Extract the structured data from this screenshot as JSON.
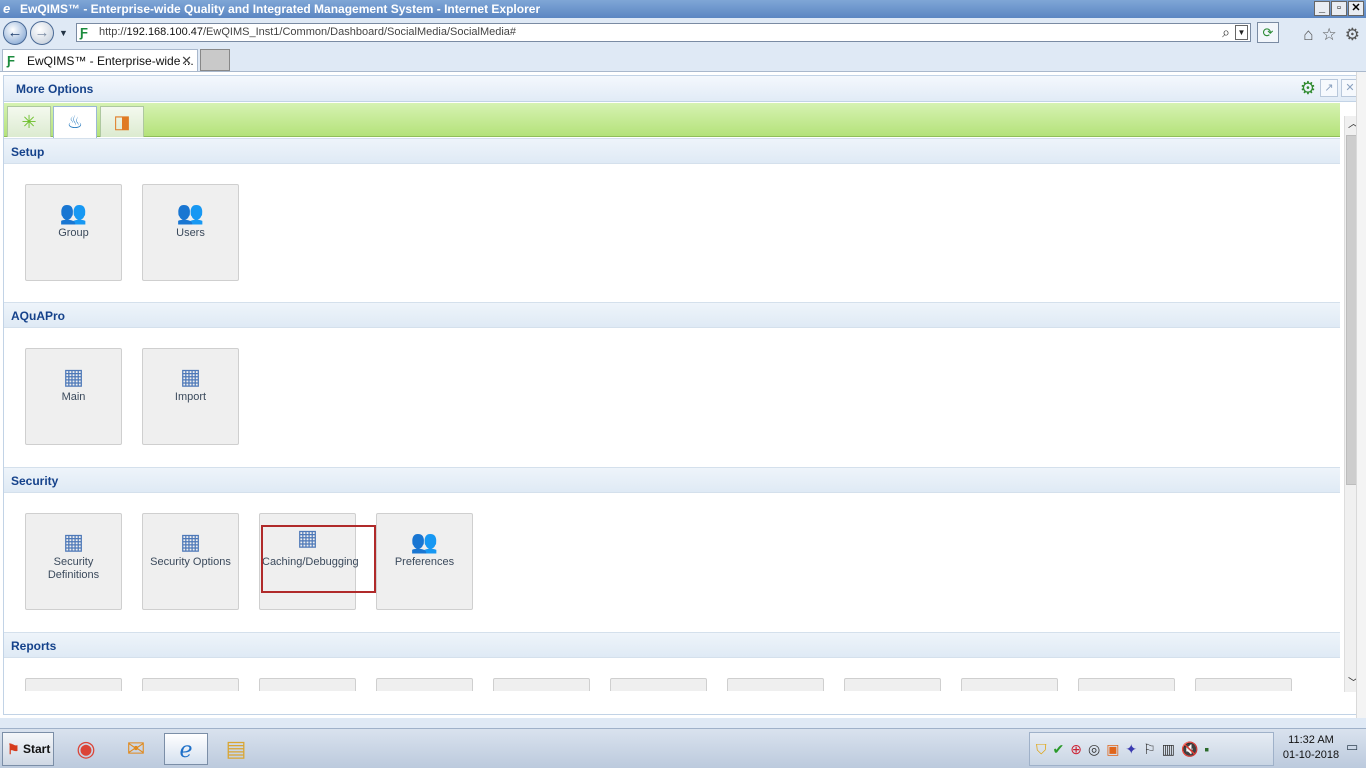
{
  "window": {
    "title": "EwQIMS™ - Enterprise-wide Quality and Integrated Management System - Internet Explorer",
    "buttons": {
      "minimize": "_",
      "maximize": "▫",
      "close": "✕"
    }
  },
  "address_bar": {
    "url_prefix": "http://",
    "url_host": "192.168.100.47",
    "url_path": "/EwQIMS_Inst1/Common/Dashboard/SocialMedia/SocialMedia#"
  },
  "browser_tab": {
    "title": "EwQIMS™ - Enterprise-wide ...",
    "close": "✕"
  },
  "panel": {
    "title": "More Options",
    "icon_tabs": [
      {
        "icon": "asterisk-icon",
        "active": false
      },
      {
        "icon": "drop-icon",
        "active": true
      },
      {
        "icon": "document-icon",
        "active": false
      }
    ]
  },
  "sections": [
    {
      "title": "Setup",
      "tiles": [
        {
          "label": "Group",
          "icon": "group-icon"
        },
        {
          "label": "Users",
          "icon": "users-icon"
        }
      ]
    },
    {
      "title": "AQuAPro",
      "tiles": [
        {
          "label": "Main",
          "icon": "document-icon"
        },
        {
          "label": "Import",
          "icon": "document-icon"
        }
      ]
    },
    {
      "title": "Security",
      "tiles": [
        {
          "label": "Security Definitions",
          "icon": "document-icon"
        },
        {
          "label": "Security Options",
          "icon": "document-icon"
        },
        {
          "label": "Caching/Debugging",
          "icon": "document-icon",
          "highlighted": true
        },
        {
          "label": "Preferences",
          "icon": "users-icon"
        }
      ]
    },
    {
      "title": "Reports",
      "tiles": []
    }
  ],
  "taskbar": {
    "start_label": "Start",
    "apps": [
      "chrome-icon",
      "outlook-icon",
      "internet-explorer-icon",
      "file-explorer-icon"
    ],
    "clock": {
      "time": "11:32 AM",
      "date": "01-10-2018"
    }
  },
  "colors": {
    "accent": "#15428b",
    "highlight_border": "#b02a2a",
    "iconbar_green": "#b4e27a"
  }
}
